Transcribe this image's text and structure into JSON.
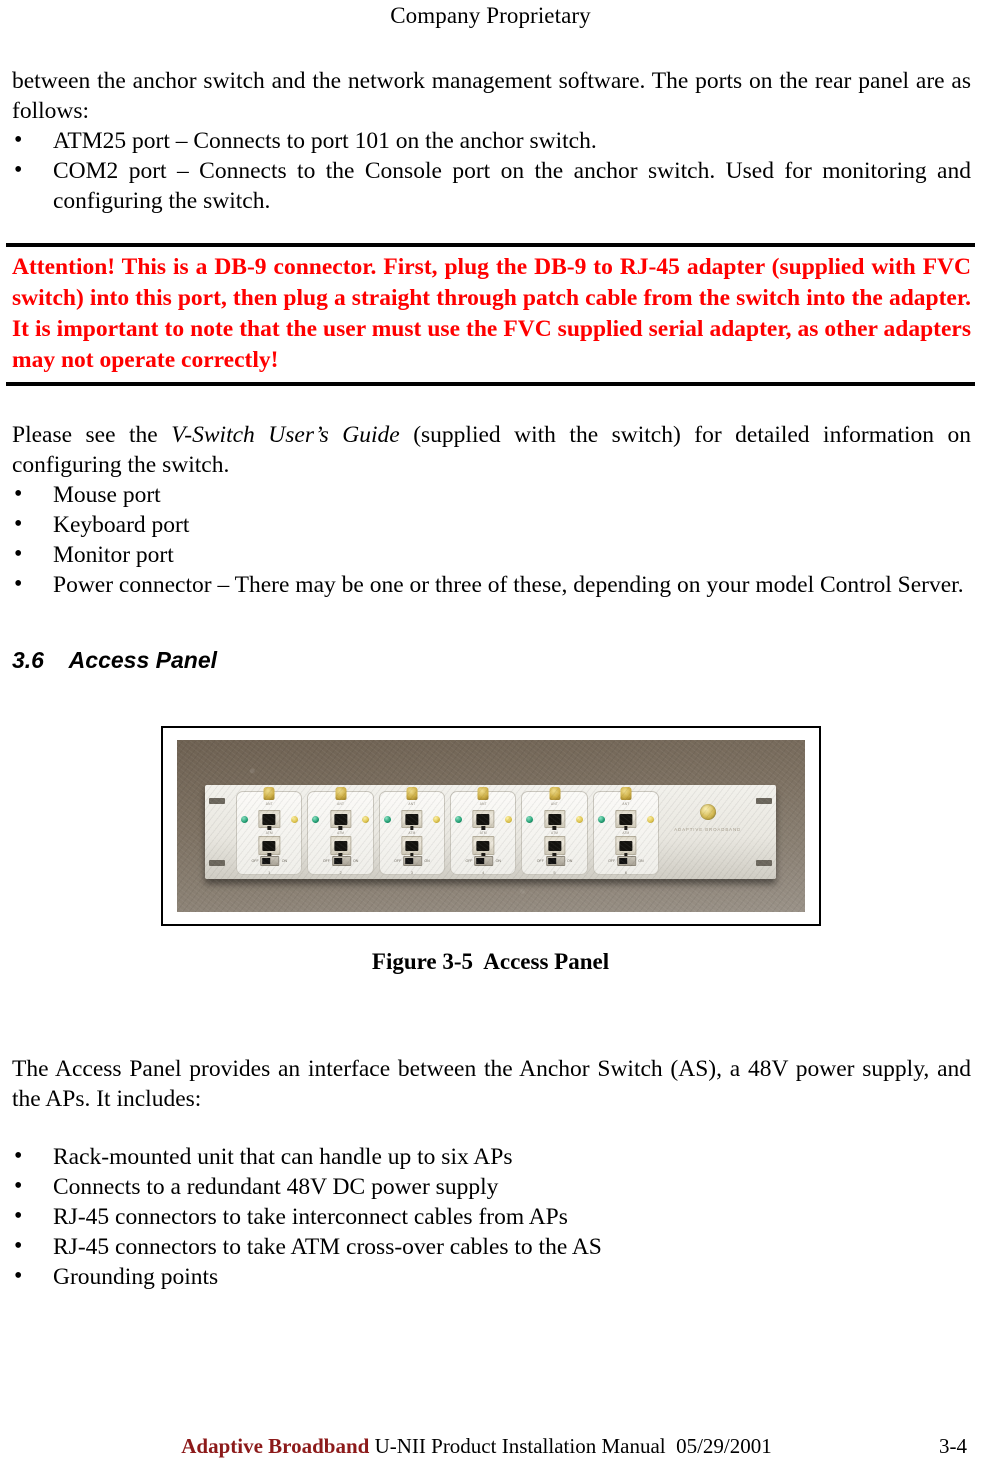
{
  "header": {
    "title": "Company Proprietary"
  },
  "intro": {
    "paragraph": "between the anchor switch and the network management software. The ports on the rear panel are as follows:",
    "bullets": [
      "ATM25 port – Connects to port 101 on the anchor switch.",
      "COM2 port – Connects to the Console port on the anchor switch.  Used for monitoring and configuring the switch."
    ]
  },
  "attention": {
    "text": "Attention!  This is a DB-9 connector.  First, plug the DB-9 to RJ-45 adapter (supplied with FVC switch) into this port, then plug a straight through patch cable from the switch into the adapter.  It is important to note that the user must use the FVC supplied serial adapter, as other adapters may not operate correctly!",
    "color": "#ff0000",
    "rule_color": "#000000"
  },
  "guide": {
    "lead_before": "Please see the ",
    "lead_italic": "V-Switch User’s Guide",
    "lead_after": " (supplied with the switch) for detailed information on configuring the switch.",
    "bullets": [
      "Mouse port",
      "Keyboard port",
      "Monitor port",
      "Power connector – There may be one or three of these, depending on your model Control Server."
    ]
  },
  "section": {
    "number": "3.6",
    "title": "Access Panel",
    "heading": "3.6    Access Panel"
  },
  "figure": {
    "caption": "Figure 3-5  Access Panel",
    "alt": "Photograph of rack-mounted access panel on carpet",
    "panel": {
      "module_count": 6,
      "module_numbers": [
        "1",
        "2",
        "3",
        "4",
        "5",
        "6"
      ],
      "antenna_label": "ANT",
      "jack_top_label": "ATM",
      "jack_bottom_label": "AP",
      "switch_off_label": "OFF",
      "switch_on_label": "ON",
      "brand_text": "ADAPTIVE BROADBAND"
    }
  },
  "body": {
    "paragraph": "The Access Panel provides an interface between the Anchor Switch (AS), a 48V power supply, and the APs.  It includes:",
    "bullets": [
      "Rack-mounted unit that can handle up to six APs",
      "Connects to a redundant 48V DC power supply",
      "RJ-45 connectors to take interconnect cables from APs",
      "RJ-45 connectors to take ATM cross-over cables to the AS",
      "Grounding points"
    ]
  },
  "footer": {
    "brand": "Adaptive Broadband",
    "doc_title": " U-NII Product Installation Manual  05/29/2001",
    "page_number": "3-4",
    "brand_color": "#8c1a1a"
  }
}
